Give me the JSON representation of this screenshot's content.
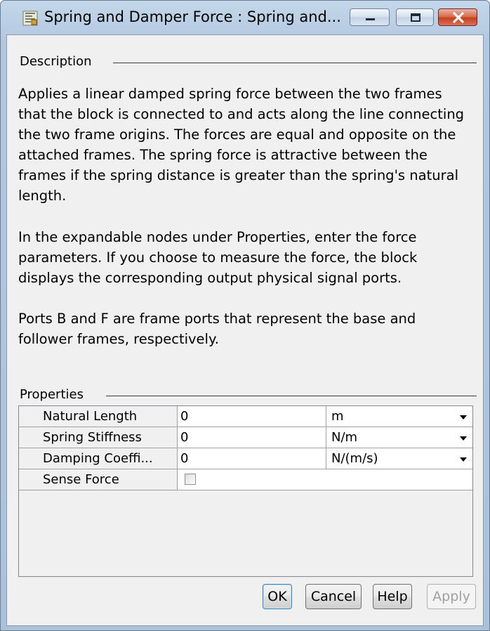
{
  "window": {
    "title": "Spring and Damper Force : Spring and...",
    "accent_color": "#b2c8e0",
    "close_color": "#c3421f"
  },
  "caption_buttons": {
    "minimize": "minimize-icon",
    "maximize": "maximize-icon",
    "close": "close-icon"
  },
  "description": {
    "label": "Description",
    "paragraphs": [
      "Applies a linear damped spring force between the two frames that the block is connected to and acts along the line connecting the two frame origins. The forces are equal and opposite on the attached frames. The spring force is attractive between the frames if the spring distance is greater than the spring's natural length.",
      "In the expandable nodes under Properties, enter the force parameters. If you choose to measure the force, the block displays the corresponding output physical signal ports.",
      "Ports B and F are frame ports that represent the base and follower frames, respectively."
    ]
  },
  "properties": {
    "label": "Properties",
    "rows": [
      {
        "name": "Natural Length",
        "value": "0",
        "unit": "m"
      },
      {
        "name": "Spring Stiffness",
        "value": "0",
        "unit": "N/m"
      },
      {
        "name": "Damping Coeffi...",
        "value": "0",
        "unit": "N/(m/s)"
      },
      {
        "name": "Sense Force",
        "checked": false
      }
    ]
  },
  "buttons": {
    "ok": "OK",
    "cancel": "Cancel",
    "help": "Help",
    "apply": "Apply"
  }
}
